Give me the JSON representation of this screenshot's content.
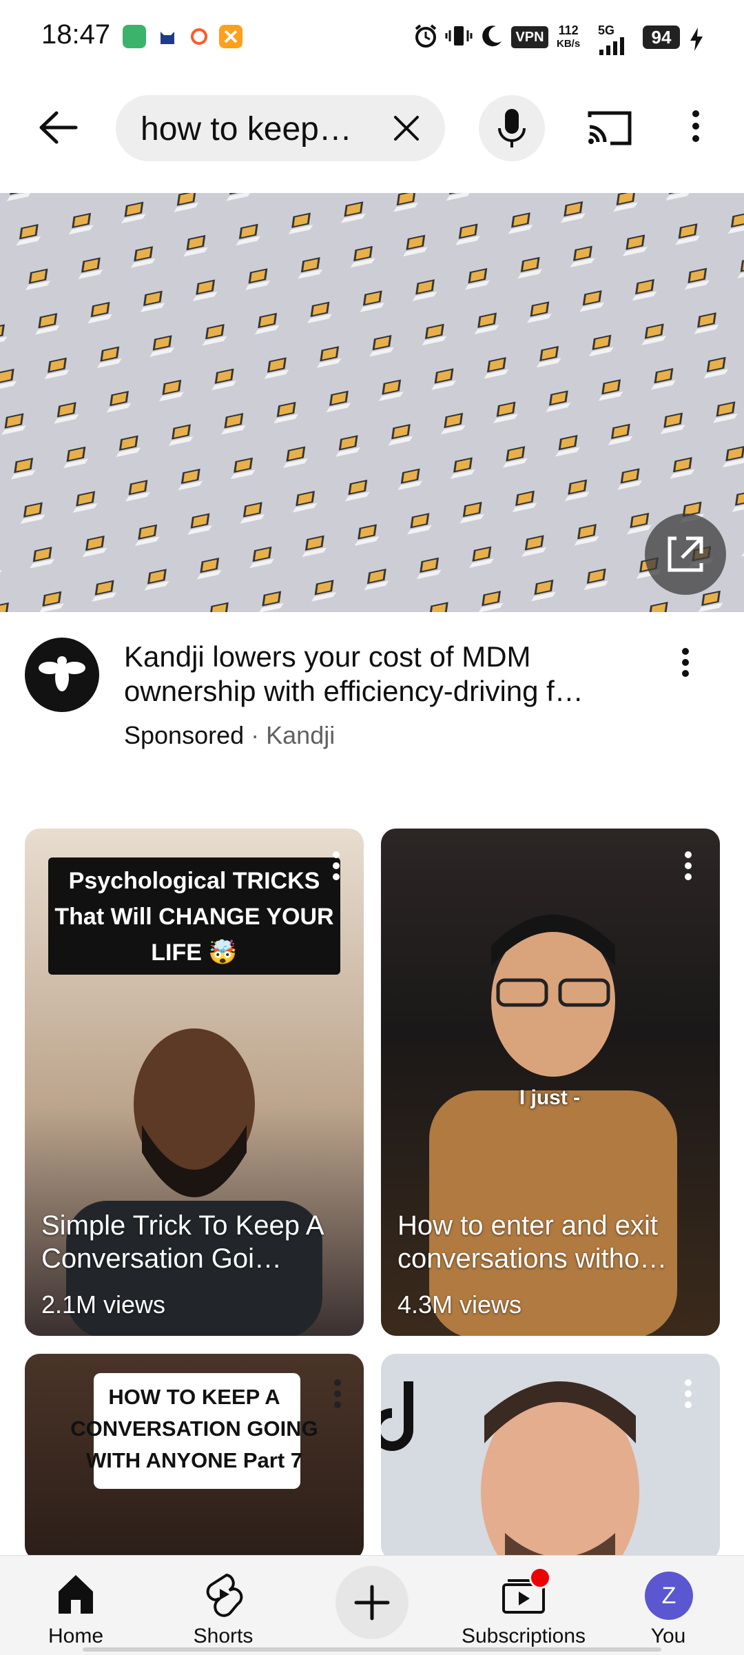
{
  "status_bar": {
    "time": "18:47",
    "vpn": "VPN",
    "speed_value": "112",
    "speed_unit": "KB/s",
    "network": "5G",
    "battery": "94"
  },
  "search": {
    "query": "how to keep…"
  },
  "ad": {
    "title": "Kandji lowers your cost of MDM ownership with efficiency-driving f…",
    "label": "Sponsored",
    "separator": "·",
    "advertiser": "Kandji"
  },
  "shorts": [
    {
      "overlay_caption": "Psychological TRICKS That Will CHANGE YOUR LIFE 🤯",
      "title": "Simple Trick To Keep A Conversation Goi…",
      "views": "2.1M views",
      "bg": "#cdb9a6"
    },
    {
      "overlay_caption": "I just -",
      "title": "How to enter and exit conversations witho…",
      "views": "4.3M views",
      "bg": "#2a2626"
    },
    {
      "overlay_caption": "HOW TO KEEP A CONVERSATION GOING WITH ANYONE Part 7",
      "bg": "#3a2a22"
    },
    {
      "overlay_caption": "",
      "bg": "#d9dde4"
    }
  ],
  "nav": {
    "home": "Home",
    "shorts": "Shorts",
    "subscriptions": "Subscriptions",
    "you": "You",
    "avatar_initial": "Z"
  },
  "colors": {
    "accent_red": "#ee0000",
    "avatar_purple": "#5b57d1"
  }
}
